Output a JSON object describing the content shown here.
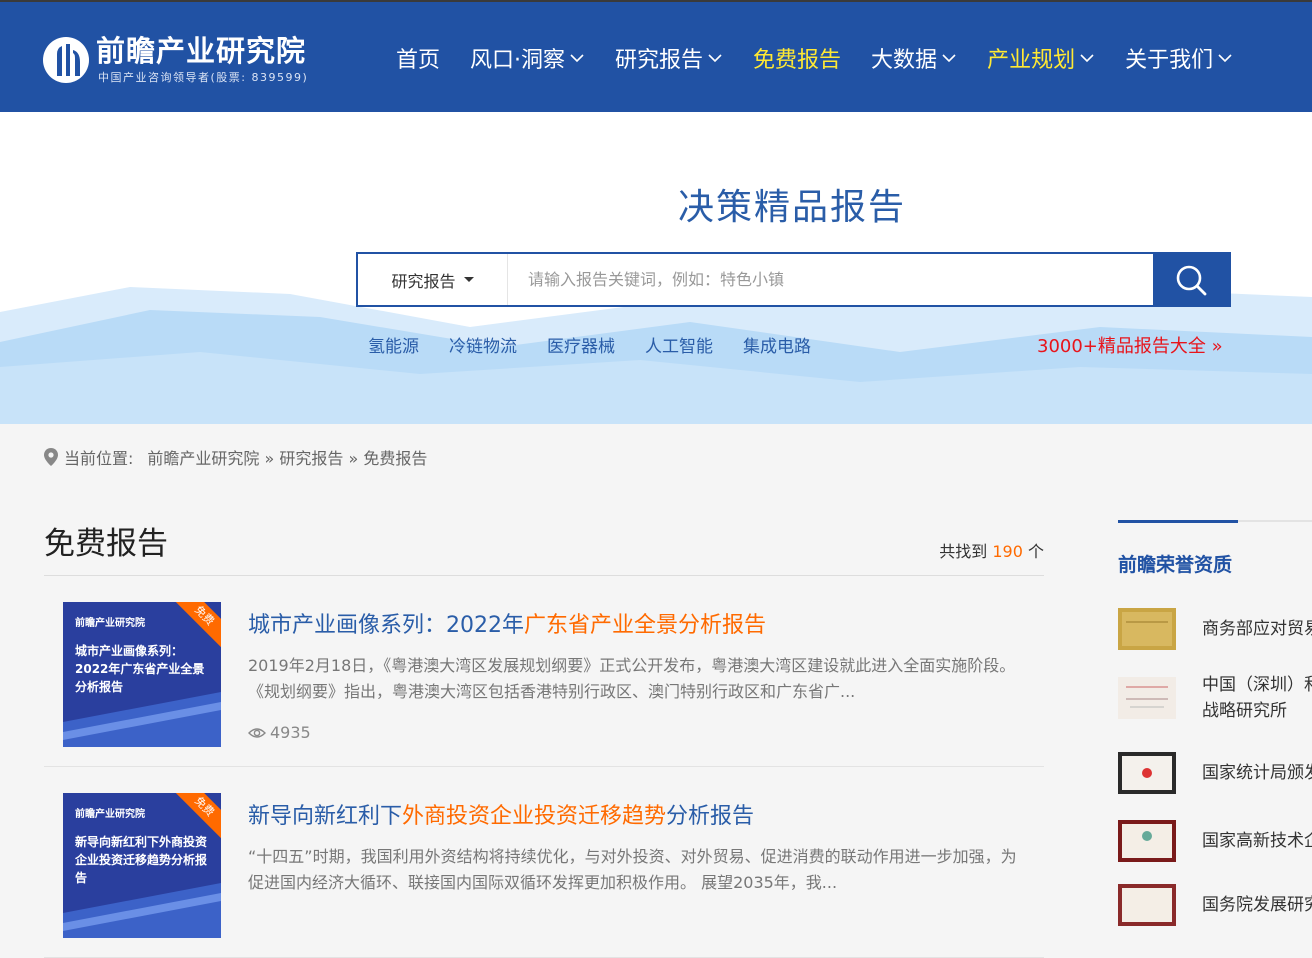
{
  "header": {
    "logo_title": "前瞻产业研究院",
    "logo_sub": "中国产业咨询领导者(股票: 839599)",
    "nav": [
      {
        "label": "首页",
        "dropdown": false,
        "highlight": false
      },
      {
        "label": "风口·洞察",
        "dropdown": true,
        "highlight": false
      },
      {
        "label": "研究报告",
        "dropdown": true,
        "highlight": false
      },
      {
        "label": "免费报告",
        "dropdown": false,
        "highlight": true
      },
      {
        "label": "大数据",
        "dropdown": true,
        "highlight": false
      },
      {
        "label": "产业规划",
        "dropdown": true,
        "highlight": true
      },
      {
        "label": "关于我们",
        "dropdown": true,
        "highlight": false
      }
    ]
  },
  "hero": {
    "title": "决策精品报告",
    "search_type": "研究报告",
    "search_placeholder": "请输入报告关键词，例如：特色小镇",
    "hot_tags": [
      "氢能源",
      "冷链物流",
      "医疗器械",
      "人工智能",
      "集成电路"
    ],
    "more_link": "3000+精品报告大全 »"
  },
  "breadcrumb": {
    "prefix": "当前位置:",
    "path": "前瞻产业研究院 » 研究报告 » 免费报告"
  },
  "main": {
    "title": "免费报告",
    "count_prefix": "共找到",
    "count": "190",
    "count_suffix": "个",
    "items": [
      {
        "title_pre": "城市产业画像系列：2022年",
        "title_hl": "广东省产业全景分析报告",
        "title_post": "",
        "desc": "2019年2月18日，《粤港澳大湾区发展规划纲要》正式公开发布，粤港澳大湾区建设就此进入全面实施阶段。《规划纲要》指出，粤港澳大湾区包括香港特别行政区、澳门特别行政区和广东省广...",
        "views": "4935",
        "cover_logo": "前瞻产业研究院",
        "cover_text": "城市产业画像系列：2022年广东省产业全景分析报告",
        "badge": "免费"
      },
      {
        "title_pre": "新导向新红利下",
        "title_hl": "外商投资企业投资迁移趋势",
        "title_post": "分析报告",
        "desc": "“十四五”时期，我国利用外资结构将持续优化，与对外投资、对外贸易、促进消费的联动作用进一步加强，为促进国内经济大循环、联接国内国际双循环发挥更加积极作用。 展望2035年，我...",
        "views": "",
        "cover_logo": "前瞻产业研究院",
        "cover_text": "新导向新红利下外商投资企业投资迁移趋势分析报告",
        "badge": "免费"
      }
    ]
  },
  "sidebar": {
    "title": "前瞻荣誉资质",
    "honors": [
      {
        "text": "商务部应对贸易"
      },
      {
        "text": "中国（深圳）和",
        "text2": "战略研究所"
      },
      {
        "text": "国家统计局颁发"
      },
      {
        "text": "国家高新技术企"
      },
      {
        "text": "国务院发展研究"
      }
    ]
  },
  "colors": {
    "brand_blue": "#2152a4",
    "highlight_yellow": "#ffe933",
    "accent_orange": "#ff6a00",
    "link_red": "#e8141b"
  }
}
